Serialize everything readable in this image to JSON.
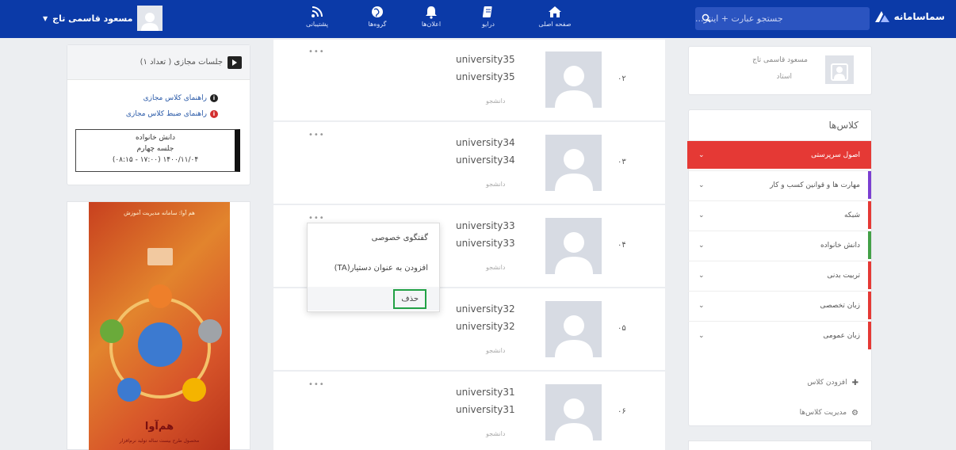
{
  "brand": {
    "name": "سماسامانه"
  },
  "search": {
    "placeholder": "جستجو عبارت + اینتر..."
  },
  "nav": [
    {
      "label": "صفحه اصلی",
      "icon": "home-icon"
    },
    {
      "label": "درایو",
      "icon": "drive-icon"
    },
    {
      "label": "اعلان‌ها",
      "icon": "bell-icon"
    },
    {
      "label": "گروه‌ها",
      "icon": "globe-icon"
    },
    {
      "label": "پشتیبانی",
      "icon": "rss-icon"
    }
  ],
  "user": {
    "name": "مسعود قاسمی تاج"
  },
  "profile": {
    "name": "مسعود قاسمی تاج",
    "role": "استاد"
  },
  "classes": {
    "title": "کلاس‌ها",
    "items": [
      {
        "label": "اصول سرپرستی",
        "color": "#e53935",
        "active": true
      },
      {
        "label": "مهارت ها و قوانین کسب و کار",
        "color": "#7b3fd1",
        "active": false
      },
      {
        "label": "شبکه",
        "color": "#e53935",
        "active": false
      },
      {
        "label": "دانش خانواده",
        "color": "#43a047",
        "active": false
      },
      {
        "label": "تربیت بدنی",
        "color": "#e53935",
        "active": false
      },
      {
        "label": "زبان تخصصی",
        "color": "#e53935",
        "active": false
      },
      {
        "label": "زبان عمومی",
        "color": "#e53935",
        "active": false
      }
    ],
    "add_class": "افزودن کلاس",
    "manage_classes": "مدیریت کلاس‌ها"
  },
  "members": [
    {
      "num": "۰۲",
      "user1": "university35",
      "user2": "university35",
      "role": "دانشجو"
    },
    {
      "num": "۰۳",
      "user1": "university34",
      "user2": "university34",
      "role": "دانشجو"
    },
    {
      "num": "۰۴",
      "user1": "university33",
      "user2": "university33",
      "role": "دانشجو"
    },
    {
      "num": "۰۵",
      "user1": "university32",
      "user2": "university32",
      "role": "دانشجو"
    },
    {
      "num": "۰۶",
      "user1": "university31",
      "user2": "university31",
      "role": "دانشجو"
    }
  ],
  "dropdown": {
    "private_chat": "گفتگوی خصوصی",
    "add_ta": "افزودن به عنوان دستیار(TA)",
    "delete": "حذف"
  },
  "sessions": {
    "title": "جلسات مجازی ( تعداد ۱)",
    "guide_virtual": "راهنمای کلاس مجازی",
    "guide_record": "راهنمای ضبط کلاس مجازی",
    "session_course": "دانش خانواده",
    "session_name": "جلسه چهارم",
    "session_time": "۱۴۰۰/۱۱/۰۴ (۱۷:۰۰ - ۰۸:۱۵)"
  },
  "poster": {
    "top_text": "هم آوا: سامانه مدیریت آموزش",
    "title": "هم‌آوا",
    "subtitle": "محصول طرح بیست ساله تولید نرم‌افزار"
  }
}
